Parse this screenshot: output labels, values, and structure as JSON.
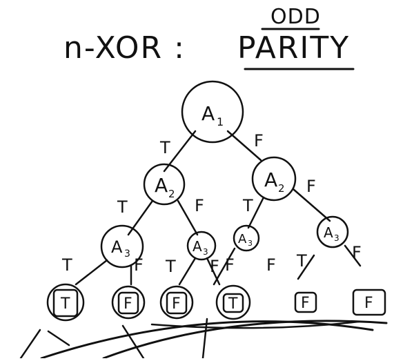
{
  "title": {
    "prefix": "n-XOR :",
    "word": "PARITY",
    "annotation": "ODD"
  },
  "tree": {
    "root": {
      "label": "A",
      "sub": "1"
    },
    "level2": [
      {
        "label": "A",
        "sub": "2"
      },
      {
        "label": "A",
        "sub": "2"
      }
    ],
    "level3": [
      {
        "label": "A",
        "sub": "3"
      },
      {
        "label": "A",
        "sub": "3"
      },
      {
        "label": "A",
        "sub": "3"
      },
      {
        "label": "A",
        "sub": "3"
      }
    ],
    "leaves": [
      "T",
      "F",
      "F",
      "T",
      "F",
      "F"
    ],
    "edge_labels": {
      "true": "T",
      "false": "F"
    }
  }
}
